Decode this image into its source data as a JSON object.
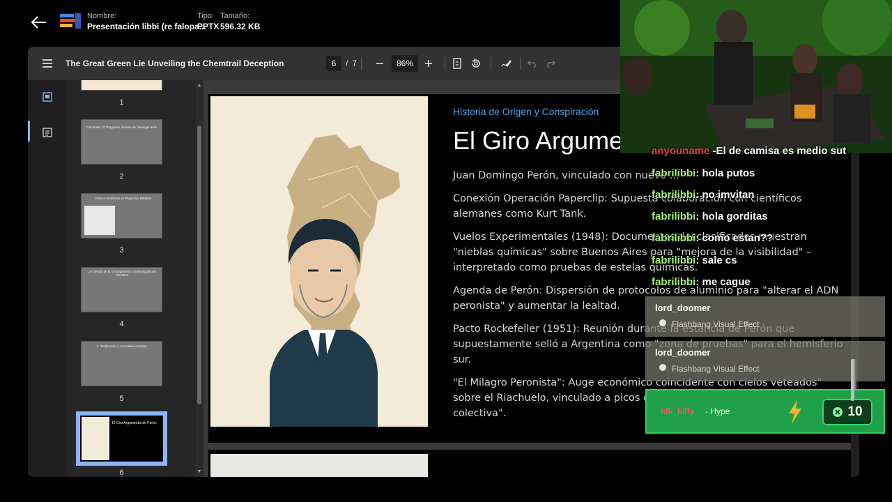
{
  "file": {
    "name_label": "Nombre:",
    "name_value": "Presentación libbi (re falopa...",
    "type_label": "Tipo:",
    "type_value": "PPTX",
    "size_label": "Tamaño:",
    "size_value": "596.32 KB"
  },
  "toolbar": {
    "title": "The Great Green Lie Unveiling the Chemtrail Deception",
    "page_current": "6",
    "page_separator": "/",
    "page_total": "7",
    "zoom": "86%"
  },
  "thumbnails": [
    {
      "num": "1"
    },
    {
      "num": "2",
      "caption": "Chemtrails: El Programa Secreto de Geoingeniería"
    },
    {
      "num": "3",
      "caption": "Raíces Históricas en Proyectos Militares"
    },
    {
      "num": "4",
      "caption": "La Ciencia de la Geoingeniería y la Manipulación Climática"
    },
    {
      "num": "5",
      "caption": "5. Testimonios y Anomalías Actuales"
    },
    {
      "num": "6",
      "caption": "El Giro Argumental de Perón"
    }
  ],
  "slide": {
    "subtitle": "Historia de Origen y Conspiración",
    "title": "El Giro Argume",
    "paragraphs": [
      "Juan Domingo Perón, vinculado con nuevo ...",
      "Conexión Operación Paperclip: Supuesta colaboración con científicos alemanes como Kurt Tank.",
      "Vuelos Experimentales (1948): Documentos desclasificados muestran \"nieblas químicas\" sobre Buenos Aires para \"mejora de la visibilidad\" – interpretado como pruebas de estelas químicas.",
      "Agenda de Perón: Dispersión de protocolos de aluminio para \"alterar el ADN peronista\" y aumentar la lealtad.",
      "Pacto Rockefeller (1951): Reunión durante la estancia de Perón que supuestamente selló a Argentina como \"zona de pruebas\" para el hemisferio sur.",
      "\"El Milagro Peronista\": Auge económico coincidente con cielos veteados\" sobre el Riachuelo, vinculado a picos de nanopartículas y \"sumisión colectiva\"."
    ]
  },
  "chat": {
    "partial_top": "-El de camisa es medio sut",
    "messages": [
      {
        "user": "fabrilibbi",
        "text": ": hola putos"
      },
      {
        "user": "fabrilibbi",
        "text": ": no imvitan"
      },
      {
        "user": "fabrilibbi",
        "text": ": hola gorditas"
      },
      {
        "user": "fabrilibbi",
        "text": ": como estan??"
      },
      {
        "user": "fabrilibbi",
        "text": ": sale cs"
      },
      {
        "user": "fabrilibbi",
        "text": ": me cague"
      }
    ],
    "events": [
      {
        "user": "lord_doomer",
        "text": "Flashbang Visual Effect"
      },
      {
        "user": "lord_doomer",
        "text": "Flashbang Visual Effect"
      }
    ],
    "hype": {
      "user": "idk_billy",
      "tag": "- Hype",
      "points": "10"
    }
  },
  "colors": {
    "accent_blue": "#8ab4f8",
    "chat_user_green": "#a6f27a",
    "hype_green": "#1fa048",
    "subtitle_blue": "#4ea5e8"
  }
}
